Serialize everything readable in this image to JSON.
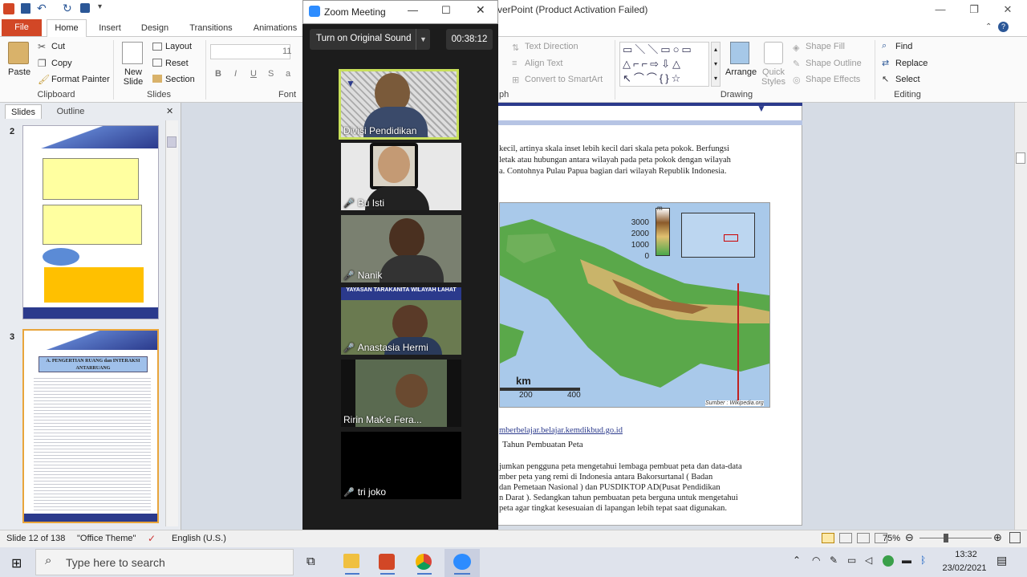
{
  "window": {
    "title": "verPoint (Product Activation Failed)"
  },
  "qat": {
    "icons": [
      "ppt-icon",
      "save-icon",
      "undo-icon",
      "redo-icon",
      "customize-icon"
    ]
  },
  "tabs": {
    "file": "File",
    "home": "Home",
    "insert": "Insert",
    "design": "Design",
    "transitions": "Transitions",
    "animations": "Animations"
  },
  "ribbon": {
    "clipboard": {
      "paste": "Paste",
      "cut": "Cut",
      "copy": "Copy",
      "format_painter": "Format Painter",
      "label": "Clipboard"
    },
    "slides": {
      "new_slide": "New Slide",
      "layout": "Layout",
      "reset": "Reset",
      "section": "Section",
      "label": "Slides"
    },
    "font": {
      "label": "Font",
      "size_value": "11"
    },
    "paragraph": {
      "text_direction": "Text Direction",
      "align_text": "Align Text",
      "convert_smartart": "Convert to SmartArt",
      "label": "ph"
    },
    "drawing": {
      "arrange": "Arrange",
      "quick_styles": "Quick Styles",
      "shape_fill": "Shape Fill",
      "shape_outline": "Shape Outline",
      "shape_effects": "Shape Effects",
      "label": "Drawing"
    },
    "editing": {
      "find": "Find",
      "replace": "Replace",
      "select": "Select",
      "label": "Editing"
    }
  },
  "leftpane": {
    "tab_slides": "Slides",
    "tab_outline": "Outline",
    "slide2_num": "2",
    "slide3_num": "3",
    "slide3_title": "A. PENGERTIAN RUANG dan INTERAKSI ANTARRUANG"
  },
  "zoom": {
    "title": "Zoom Meeting",
    "sound_button": "Turn on Original Sound",
    "timer": "00:38:12",
    "participants": [
      {
        "name": "Divisi Pendidikan",
        "muted": false
      },
      {
        "name": "Bu Isti",
        "muted": true
      },
      {
        "name": "Nanik",
        "muted": true
      },
      {
        "name": "Anastasia Hermi",
        "muted": true
      },
      {
        "name": "Ririn Mak'e Fera...",
        "muted": false
      },
      {
        "name": "tri joko",
        "muted": true
      }
    ],
    "tile3_banner": "YAYASAN TARAKANITA WILAYAH LAHAT"
  },
  "slide": {
    "lines": [
      "kecil,  artinya skala inset lebih kecil  dari  skala peta pokok. Berfungsi",
      "letak atau hubungan  antara wilayah pada peta pokok dengan  wilayah",
      "a. Contohnya Pulau Papua bagian  dari wilayah Republik Indonesia."
    ],
    "map_legend_unit": "m",
    "map_legend_ticks": [
      "3000",
      "2000",
      "1000",
      "0"
    ],
    "map_scale_label": "km",
    "map_scale_ticks": [
      "200",
      "400"
    ],
    "map_source": "Sumber : Wikipedia.org",
    "link": "mberbelajar.belajar.kemdikbud.go.id",
    "heading": "Tahun Pembuatan Peta",
    "para": [
      "jumkan  pengguna  peta mengetahui  lembaga  pembuat peta dan data-data",
      "mber peta yang remi di Indonesia antara Bakorsurtanal ( Badan",
      "dan Pemetaan Nasional ) dan PUSDIKTOP AD(Pusat Pendidikan",
      "n Darat ). Sedangkan  tahun pembuatan peta berguna untuk mengetahui",
      "peta agar  tingkat kesesuaian  di lapangan  lebih  tepat saat digunakan."
    ]
  },
  "status": {
    "slide": "Slide 12 of 138",
    "theme": "\"Office Theme\"",
    "language": "English (U.S.)",
    "zoom": "75%"
  },
  "taskbar": {
    "search_placeholder": "Type here to search",
    "time": "13:32",
    "date": "23/02/2021"
  },
  "colors": {
    "file_tab": "#d24726",
    "zoom_bg": "#1c1c1c",
    "active_speaker": "#c8e05a",
    "slide_band": "#2b3a8c"
  }
}
